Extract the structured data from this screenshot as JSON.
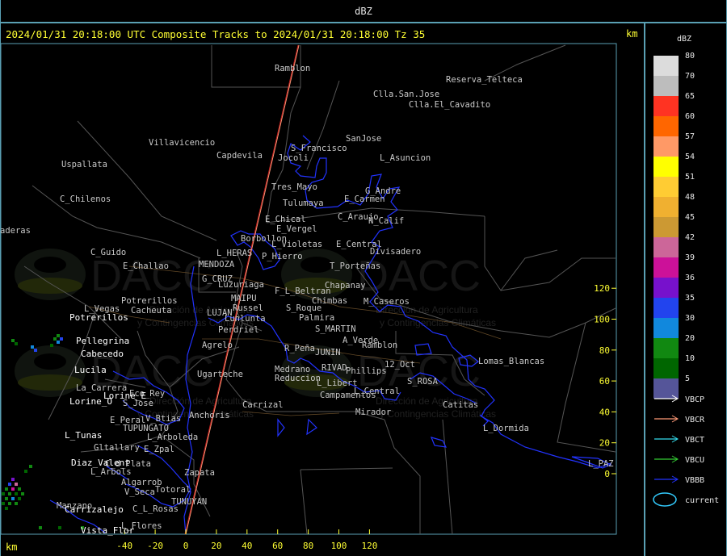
{
  "title": "dBZ",
  "header": "2024/01/31 20:18:00 UTC Composite Tracks to 2024/01/31 20:18:00 Tz 35",
  "axis_unit_top": "km",
  "axis_unit_bottom": "km",
  "legend": {
    "title": "dBZ",
    "levels": [
      {
        "value": "80",
        "color": "#dcdcdc"
      },
      {
        "value": "70",
        "color": "#bdbdbd"
      },
      {
        "value": "65",
        "color": "#ff3322"
      },
      {
        "value": "60",
        "color": "#ff6600"
      },
      {
        "value": "57",
        "color": "#ff9966"
      },
      {
        "value": "54",
        "color": "#ffff00"
      },
      {
        "value": "51",
        "color": "#ffcc33"
      },
      {
        "value": "48",
        "color": "#f0b030"
      },
      {
        "value": "45",
        "color": "#cc9933"
      },
      {
        "value": "42",
        "color": "#cc6699"
      },
      {
        "value": "39",
        "color": "#cc1199"
      },
      {
        "value": "36",
        "color": "#7711cc"
      },
      {
        "value": "35",
        "color": "#2244ee"
      },
      {
        "value": "30",
        "color": "#1188dd"
      },
      {
        "value": "20",
        "color": "#118811"
      },
      {
        "value": "10",
        "color": "#006600"
      },
      {
        "value": "5",
        "color": "#555599"
      }
    ],
    "tracks": [
      {
        "label": "VBCP",
        "color": "#ffffff"
      },
      {
        "label": "VBCR",
        "color": "#ff9977"
      },
      {
        "label": "VBCT",
        "color": "#33ddee"
      },
      {
        "label": "VBCU",
        "color": "#33cc33"
      },
      {
        "label": "VBBB",
        "color": "#2233ff"
      }
    ],
    "current_label": "current",
    "current_color": "#33ccff"
  },
  "x_ticks": [
    "-40",
    "-20",
    "0",
    "20",
    "40",
    "60",
    "80",
    "100",
    "120"
  ],
  "y_ticks": [
    "120",
    "100",
    "80",
    "60",
    "40",
    "20",
    "0"
  ],
  "places_gray": [
    "Ramblon",
    "Reserva_Telteca",
    "Clla.San.Jose",
    "Clla.El_Cavadito",
    "SanJose",
    "L_Asuncion",
    "Villavicencio",
    "Capdevila",
    "S_Francisco",
    "Jocoli",
    "Uspallata",
    "Tres_Mayo",
    "G_Andre",
    "E_Carmen",
    "C_Chilenos",
    "Tulumaya",
    "C_Araujo",
    "N_Calif",
    "E_Chical",
    "E_Vergel",
    "aderas",
    "Borbollon",
    "L_Violetas",
    "E_Central",
    "Divisadero",
    "C_Guido",
    "L_HERAS",
    "P_Hierro",
    "E_Challao",
    "MENDOZA",
    "T_Porteñas",
    "G_CRUZ",
    "Luzuriaga",
    "Chapanay",
    "F_L_Beltran",
    "MAIPU",
    "Chimbas",
    "M_Caseros",
    "Potrerillos",
    "Cacheuta",
    "L_Vegas",
    "Russel",
    "LUJAN",
    "S_Roque",
    "Lunlunta",
    "Palmira",
    "Perdriel",
    "S_MARTIN",
    "A_Verde",
    "Ramblon",
    "Agrelo",
    "R_Peña",
    "JUNIN",
    "Lomas_Blancas",
    "RIVAD",
    "Phillips",
    "12_Oct",
    "Medrano",
    "Ugarteche",
    "Reduccion",
    "S_ROSA",
    "L_Libert",
    "La_Carrera",
    "Campamentos",
    "L_Central",
    "Eco_Rey",
    "S_Jose",
    "Carrizal",
    "Catitas",
    "E_Peral",
    "V_Btias",
    "Mirador",
    "Anchoris",
    "TUPUNGATO",
    "L_Dormida",
    "L_Arboleda",
    "Gltallary",
    "E_Zpal",
    "L_PAZ",
    "C_d_Plata",
    "L_Arbols",
    "Zapata",
    "Algarrob",
    "V_Seca",
    "Totoral",
    "Manzano",
    "C_L_Rosas",
    "TUNUYAN",
    "L_Flores"
  ],
  "places_white": [
    "Potrerillos",
    "Pellegrina",
    "Cabecedo",
    "Lucila",
    "Lorine_E",
    "Lorine_O",
    "L_Tunas",
    "Diaz_Valent",
    "Carrizalejo",
    "Vista_Flor"
  ],
  "watermark": {
    "brand": "DACC",
    "line1": "Dirección de Agricultura",
    "line2": "y Contingencias Climáticas"
  }
}
